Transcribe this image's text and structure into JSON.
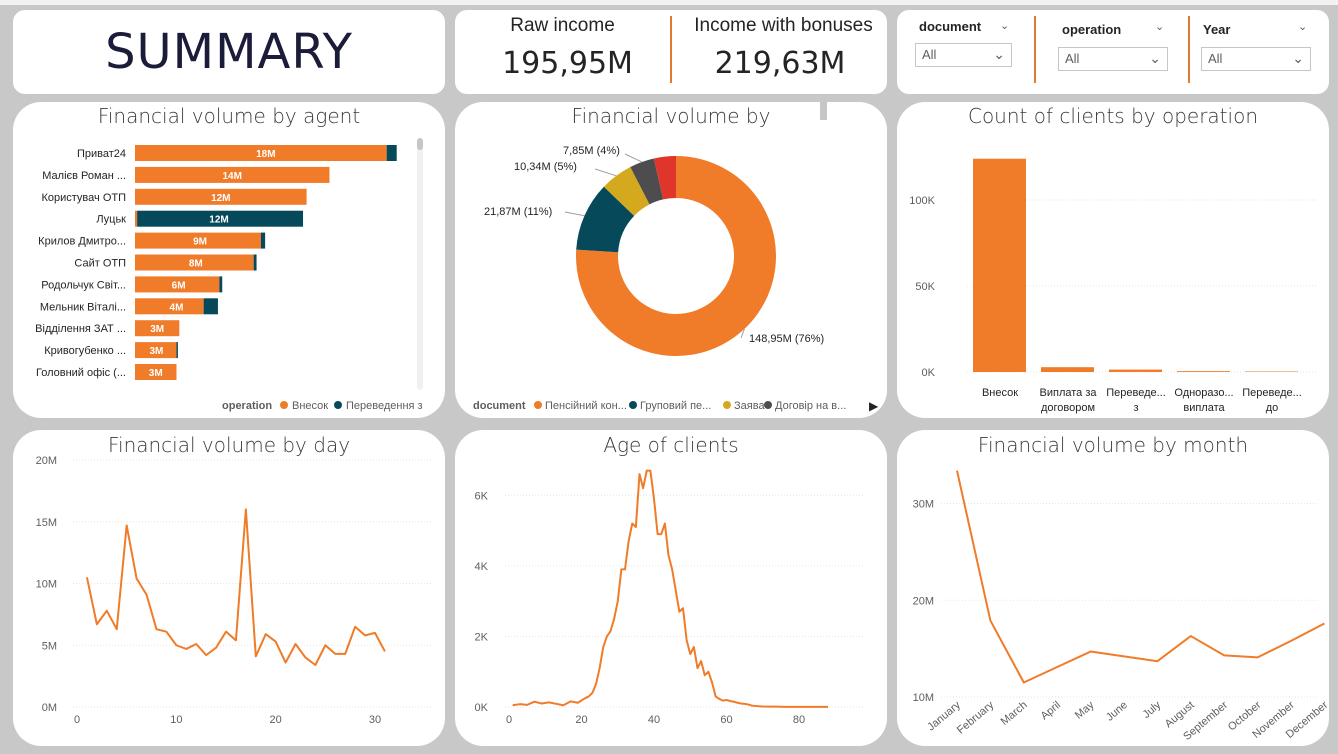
{
  "summary": {
    "title": "SUMMARY"
  },
  "kpis": {
    "raw_label": "Raw income",
    "raw_value": "195,95M",
    "bonus_label": "Income with bonuses",
    "bonus_value": "219,63M"
  },
  "slicers": [
    {
      "title": "document",
      "value": "All"
    },
    {
      "title": "operation",
      "value": "All"
    },
    {
      "title": "Year",
      "value": "All"
    }
  ],
  "colors": {
    "orange": "#f07b29",
    "teal": "#05495a",
    "yellow": "#d4a91d",
    "gray": "#4d4d4f",
    "red": "#e0352b"
  },
  "charts": {
    "agent": {
      "title": "Financial volume by agent",
      "legend_title": "operation",
      "legend_items": [
        "Внесок",
        "Переведення з"
      ],
      "rows": [
        {
          "label": "Приват24",
          "orange": 17.6,
          "teal": 0.7,
          "teal_first": false,
          "text": "18M"
        },
        {
          "label": "Малієв Роман ...",
          "orange": 13.6,
          "teal": 0,
          "teal_first": false,
          "text": "14M"
        },
        {
          "label": "Користувач ОТП",
          "orange": 12.0,
          "teal": 0,
          "teal_first": false,
          "text": "12M"
        },
        {
          "label": "Луцьк",
          "orange": 0.15,
          "teal": 11.6,
          "teal_first": false,
          "text": "12M"
        },
        {
          "label": "Крилов Дмитро...",
          "orange": 8.8,
          "teal": 0.3,
          "teal_first": false,
          "text": "9M"
        },
        {
          "label": "Сайт ОТП",
          "orange": 8.3,
          "teal": 0.2,
          "teal_first": false,
          "text": "8M"
        },
        {
          "label": "Родольчук Світ...",
          "orange": 5.9,
          "teal": 0.2,
          "teal_first": false,
          "text": "6M"
        },
        {
          "label": "Мельник Віталі...",
          "orange": 4.8,
          "teal": 1.0,
          "teal_first": false,
          "text": "4M"
        },
        {
          "label": "Відділення ЗАТ ...",
          "orange": 3.1,
          "teal": 0,
          "teal_first": false,
          "text": "3M"
        },
        {
          "label": "Кривогубенко ...",
          "orange": 2.9,
          "teal": 0.1,
          "teal_first": false,
          "text": "3M"
        },
        {
          "label": "Головний офіс (...",
          "orange": 2.9,
          "teal": 0,
          "teal_first": false,
          "text": "3M"
        }
      ]
    },
    "donut": {
      "title": "Financial volume by",
      "legend_title": "document",
      "legend_items": [
        "Пенсійний кон...",
        "Груповий пе...",
        "Заява",
        "Договір на в..."
      ],
      "slices": [
        {
          "value": 148.95,
          "label": "148,95M (76%)"
        },
        {
          "value": 21.87,
          "label": "21,87M (11%)"
        },
        {
          "value": 10.34,
          "label": "10,34M (5%)"
        },
        {
          "value": 7.85,
          "label": "7,85M (4%)"
        },
        {
          "value": 6.94,
          "label": ""
        }
      ]
    },
    "clients_op": {
      "title": "Count of clients by operation",
      "yticks": [
        "0K",
        "50K",
        "100K"
      ],
      "categories": [
        [
          "Внесок"
        ],
        [
          "Виплата за",
          "договором"
        ],
        [
          "Переведе...",
          "з"
        ],
        [
          "Одноразо...",
          "виплата"
        ],
        [
          "Переведе...",
          "до"
        ]
      ],
      "values": [
        124000,
        2800,
        1400,
        500,
        300
      ]
    },
    "day": {
      "title": "Financial volume by day",
      "yticks": [
        "0M",
        "5M",
        "10M",
        "15M",
        "20M"
      ],
      "xticks": [
        "0",
        "10",
        "20",
        "30"
      ],
      "x": [
        1,
        2,
        3,
        4,
        5,
        6,
        7,
        8,
        9,
        10,
        11,
        12,
        13,
        14,
        15,
        16,
        17,
        18,
        19,
        20,
        21,
        22,
        23,
        24,
        25,
        26,
        27,
        28,
        29,
        30,
        31
      ],
      "y": [
        10.5,
        6.7,
        7.8,
        6.3,
        14.7,
        10.4,
        9.1,
        6.3,
        6.1,
        5.0,
        4.7,
        5.1,
        4.2,
        4.8,
        6.1,
        5.4,
        16.0,
        4.1,
        5.9,
        5.3,
        3.6,
        5.1,
        4.0,
        3.4,
        5.0,
        4.3,
        4.3,
        6.5,
        5.8,
        6.0,
        4.5
      ]
    },
    "age": {
      "title": "Age of clients",
      "yticks": [
        "0K",
        "2K",
        "4K",
        "6K"
      ],
      "xticks": [
        "0",
        "20",
        "40",
        "60",
        "80"
      ],
      "x": [
        1,
        3,
        5,
        7,
        9,
        11,
        13,
        15,
        17,
        19,
        21,
        22,
        23,
        24,
        25,
        26,
        27,
        28,
        29,
        30,
        31,
        32,
        33,
        34,
        35,
        36,
        37,
        38,
        39,
        40,
        41,
        42,
        43,
        44,
        45,
        46,
        47,
        48,
        49,
        50,
        51,
        52,
        53,
        54,
        55,
        56,
        57,
        58,
        59,
        60,
        61,
        62,
        63,
        64,
        65,
        66,
        67,
        68,
        69,
        70,
        72,
        74,
        76,
        78,
        80,
        84,
        88
      ],
      "y": [
        50,
        80,
        60,
        150,
        100,
        130,
        90,
        50,
        160,
        120,
        250,
        300,
        400,
        650,
        1100,
        1700,
        2000,
        2150,
        2500,
        3000,
        3900,
        3900,
        4700,
        5200,
        5100,
        6600,
        6200,
        6700,
        6700,
        5900,
        4900,
        4900,
        5200,
        4300,
        3900,
        3300,
        2700,
        2800,
        1900,
        1500,
        1700,
        1100,
        1300,
        900,
        1000,
        700,
        300,
        230,
        180,
        200,
        170,
        150,
        120,
        100,
        90,
        70,
        40,
        30,
        20,
        15,
        10,
        10,
        5,
        5,
        5,
        5,
        5
      ]
    },
    "month": {
      "title": "Financial volume by month",
      "yticks": [
        "10M",
        "20M",
        "30M"
      ],
      "categories": [
        "January",
        "February",
        "March",
        "April",
        "May",
        "June",
        "July",
        "August",
        "September",
        "October",
        "November",
        "December"
      ],
      "values": [
        33.4,
        17.9,
        11.5,
        13.1,
        14.7,
        14.2,
        13.7,
        16.3,
        14.3,
        14.1,
        15.8,
        17.6
      ]
    }
  },
  "chart_data": [
    {
      "type": "bar",
      "title": "Financial volume by agent",
      "categories": [
        "Приват24",
        "Малієв Роман ...",
        "Користувач ОТП",
        "Луцьк",
        "Крилов Дмитро...",
        "Сайт ОТП",
        "Родольчук Світ...",
        "Мельник Віталі...",
        "Відділення ЗАТ ...",
        "Кривогубенко ...",
        "Головний офіс (..."
      ],
      "series": [
        {
          "name": "Внесок",
          "values": [
            17.6,
            13.6,
            12.0,
            0.15,
            8.8,
            8.3,
            5.9,
            4.8,
            3.1,
            2.9,
            2.9
          ]
        },
        {
          "name": "Переведення з",
          "values": [
            0.7,
            0,
            0,
            11.6,
            0.3,
            0.2,
            0.2,
            1.0,
            0,
            0.1,
            0
          ]
        }
      ]
    },
    {
      "type": "pie",
      "title": "Financial volume by",
      "values": [
        148.95,
        21.87,
        10.34,
        7.85,
        6.94
      ]
    },
    {
      "type": "bar",
      "title": "Count of clients by operation",
      "categories": [
        "Внесок",
        "Виплата за договором",
        "Переведе... з",
        "Одноразо... виплата",
        "Переведе... до"
      ],
      "values": [
        124000,
        2800,
        1400,
        500,
        300
      ],
      "ylim": [
        0,
        135000
      ]
    },
    {
      "type": "line",
      "title": "Financial volume by day",
      "ylim": [
        0,
        20
      ]
    },
    {
      "type": "line",
      "title": "Age of clients",
      "ylim": [
        0,
        7000
      ]
    },
    {
      "type": "line",
      "title": "Financial volume by month",
      "ylim": [
        10,
        35
      ]
    }
  ]
}
